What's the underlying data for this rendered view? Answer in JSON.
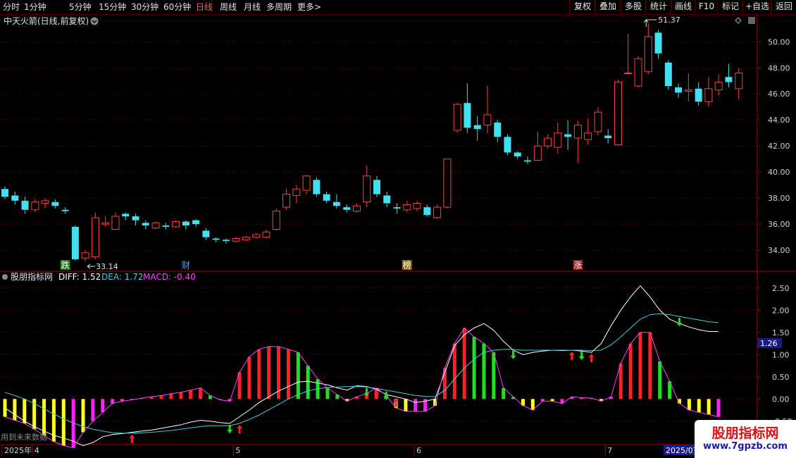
{
  "toolbar": {
    "periods": [
      "分时",
      "1分钟",
      "5分钟",
      "15分钟",
      "30分钟",
      "60分钟",
      "日线",
      "周线",
      "月线",
      "多周期",
      "更多"
    ],
    "active_period": "日线",
    "more_glyph": ">",
    "buttons": [
      "复权",
      "叠加",
      "多股",
      "统计",
      "画线",
      "F10",
      "标记",
      "+自选",
      "返回"
    ]
  },
  "main_panel": {
    "title": "中天火箭(日线,前复权)",
    "dropdown_icon": "chevron-down-icon",
    "diamond_icon": "diamond-icon",
    "high_label": "51.37",
    "low_label": "33.14",
    "markers": [
      {
        "index": 6,
        "text": "跌",
        "bg": "#1a7a1a",
        "color": "#ffffff"
      },
      {
        "index": 18,
        "text": "财",
        "bg": "#000000",
        "color": "#4aa8ff"
      },
      {
        "index": 40,
        "text": "榜",
        "bg": "#8a6a00",
        "color": "#ffffff"
      },
      {
        "index": 57,
        "text": "涨",
        "bg": "#8a1a1a",
        "color": "#ffffff"
      }
    ]
  },
  "indicator_panel": {
    "name": "股朋指标网",
    "diff_label": "DIFF: 1.52",
    "dea_label": "DEA: 1.72",
    "macd_label": "MACD: -0.40",
    "current_value": "1.26",
    "footnote": "用到未来数据"
  },
  "date_axis": {
    "labels": [
      {
        "index": 0,
        "text": "2025年"
      },
      {
        "index": 3,
        "text": "4"
      },
      {
        "index": 23,
        "text": "5"
      },
      {
        "index": 41,
        "text": "6"
      },
      {
        "index": 60,
        "text": "7"
      }
    ],
    "current_date": "2025/07"
  },
  "watermark": {
    "title": "股朋指标网",
    "url": "www.7gpzb.com"
  },
  "colors": {
    "up": "#ff4040",
    "down": "#40e0f0",
    "diff": "#ffffff",
    "dea": "#40d0e0",
    "macd_label": "#ff40ff",
    "bar_red": "#ff2020",
    "bar_green": "#20e020",
    "bar_yellow": "#ffff20",
    "bar_magenta": "#ff20ff",
    "grid": "#8b0000",
    "axis": "#b00000"
  },
  "chart_data": [
    {
      "type": "candlestick",
      "title": "中天火箭(日线,前复权)",
      "yticks": [
        34,
        36,
        38,
        40,
        42,
        44,
        46,
        48,
        50
      ],
      "ytick_labels": [
        "34.00",
        "36.00",
        "38.00",
        "40.00",
        "42.00",
        "44.00",
        "46.00",
        "48.00",
        "50.00"
      ],
      "ylim": [
        32.6,
        51.8
      ],
      "candles": [
        [
          38.7,
          38.1,
          38.9,
          37.9
        ],
        [
          38.2,
          37.8,
          38.5,
          37.5
        ],
        [
          37.8,
          37.1,
          38.1,
          36.8
        ],
        [
          37.1,
          37.7,
          37.9,
          36.9
        ],
        [
          37.6,
          37.8,
          38.0,
          37.2
        ],
        [
          37.7,
          37.4,
          37.9,
          37.2
        ],
        [
          37.1,
          37.0,
          37.3,
          36.8
        ],
        [
          35.8,
          33.3,
          35.9,
          33.2
        ],
        [
          33.4,
          33.8,
          34.0,
          33.14
        ],
        [
          33.5,
          36.5,
          36.9,
          33.3
        ],
        [
          36.0,
          36.1,
          36.6,
          35.8
        ],
        [
          35.6,
          36.6,
          36.9,
          35.6
        ],
        [
          36.8,
          36.6,
          36.9,
          36.3
        ],
        [
          36.6,
          36.3,
          36.8,
          35.9
        ],
        [
          36.1,
          35.9,
          36.3,
          35.6
        ],
        [
          35.7,
          36.1,
          36.2,
          35.6
        ],
        [
          35.9,
          35.8,
          36.1,
          35.6
        ],
        [
          35.8,
          36.2,
          36.3,
          35.7
        ],
        [
          36.2,
          35.9,
          36.3,
          35.6
        ],
        [
          36.3,
          36.0,
          36.4,
          35.8
        ],
        [
          35.5,
          35.0,
          35.7,
          34.8
        ],
        [
          34.9,
          34.8,
          35.0,
          34.6
        ],
        [
          34.8,
          34.7,
          34.9,
          34.5
        ],
        [
          34.7,
          34.9,
          35.0,
          34.6
        ],
        [
          34.8,
          35.0,
          35.1,
          34.7
        ],
        [
          35.0,
          35.2,
          35.3,
          34.9
        ],
        [
          35.0,
          35.4,
          35.6,
          34.9
        ],
        [
          35.6,
          37.0,
          37.2,
          35.5
        ],
        [
          37.3,
          38.3,
          38.7,
          37.1
        ],
        [
          38.2,
          38.7,
          39.0,
          37.6
        ],
        [
          38.6,
          39.7,
          39.8,
          38.3
        ],
        [
          39.4,
          38.3,
          39.6,
          38.1
        ],
        [
          38.3,
          37.8,
          38.5,
          37.6
        ],
        [
          37.7,
          37.4,
          38.3,
          37.2
        ],
        [
          37.3,
          37.1,
          37.5,
          36.9
        ],
        [
          37.0,
          37.4,
          37.6,
          36.9
        ],
        [
          37.7,
          39.7,
          40.5,
          37.3
        ],
        [
          39.4,
          38.3,
          39.7,
          38.1
        ],
        [
          38.2,
          37.6,
          38.5,
          37.3
        ],
        [
          37.3,
          37.2,
          37.6,
          36.8
        ],
        [
          37.1,
          37.5,
          37.8,
          36.9
        ],
        [
          37.2,
          37.6,
          37.8,
          37.0
        ],
        [
          37.3,
          36.7,
          37.5,
          36.6
        ],
        [
          36.5,
          37.3,
          37.5,
          36.4
        ],
        [
          37.3,
          41.0,
          41.0,
          37.2
        ],
        [
          43.2,
          45.2,
          45.3,
          43.0
        ],
        [
          45.3,
          43.4,
          46.8,
          43.0
        ],
        [
          43.6,
          43.3,
          44.3,
          42.4
        ],
        [
          43.6,
          44.4,
          46.6,
          43.0
        ],
        [
          43.8,
          42.7,
          44.0,
          42.3
        ],
        [
          42.7,
          41.5,
          42.9,
          41.3
        ],
        [
          41.5,
          41.2,
          41.6,
          41.0
        ],
        [
          40.9,
          40.8,
          41.2,
          40.6
        ],
        [
          40.9,
          42.0,
          43.1,
          40.9
        ],
        [
          42.0,
          42.6,
          42.9,
          41.8
        ],
        [
          41.9,
          43.0,
          43.8,
          41.4
        ],
        [
          42.9,
          42.7,
          44.0,
          41.7
        ],
        [
          42.6,
          43.6,
          43.9,
          40.7
        ],
        [
          42.5,
          43.0,
          44.1,
          42.1
        ],
        [
          43.1,
          44.6,
          45.0,
          42.8
        ],
        [
          42.8,
          42.6,
          43.3,
          42.2
        ],
        [
          42.1,
          46.9,
          47.1,
          42.0
        ],
        [
          47.6,
          47.6,
          50.6,
          47.6
        ],
        [
          46.6,
          48.7,
          48.9,
          46.5
        ],
        [
          47.7,
          50.4,
          51.37,
          47.5
        ],
        [
          50.7,
          49.1,
          50.9,
          48.7
        ],
        [
          48.4,
          46.6,
          48.6,
          46.3
        ],
        [
          46.5,
          46.1,
          46.8,
          45.7
        ],
        [
          46.2,
          46.3,
          47.6,
          45.4
        ],
        [
          46.4,
          45.4,
          46.9,
          45.1
        ],
        [
          45.4,
          46.4,
          47.3,
          45.0
        ],
        [
          46.3,
          46.9,
          47.5,
          45.9
        ],
        [
          47.3,
          46.9,
          48.3,
          46.5
        ],
        [
          46.4,
          47.6,
          48.0,
          45.6
        ]
      ]
    },
    {
      "type": "bar+line",
      "name": "股朋指标网",
      "yticks": [
        -0.5,
        0,
        0.5,
        1.0,
        1.5,
        2.0,
        2.5
      ],
      "ytick_labels": [
        "-0.50",
        "0.00",
        "0.50",
        "1.00",
        "1.50",
        "2.00",
        "2.50"
      ],
      "ylim": [
        -0.9,
        2.75
      ],
      "series": [
        {
          "name": "DIFF",
          "values": [
            -0.2,
            -0.35,
            -0.5,
            -0.62,
            -0.72,
            -0.82,
            -0.88,
            -0.95,
            -1.05,
            -0.98,
            -0.85,
            -0.8,
            -0.78,
            -0.75,
            -0.72,
            -0.7,
            -0.66,
            -0.62,
            -0.58,
            -0.52,
            -0.48,
            -0.5,
            -0.53,
            -0.55,
            -0.4,
            -0.25,
            -0.08,
            0.05,
            0.18,
            0.28,
            0.38,
            0.4,
            0.36,
            0.32,
            0.25,
            0.2,
            0.3,
            0.28,
            0.22,
            0.1,
            0.05,
            0.0,
            -0.08,
            -0.05,
            0.0,
            0.6,
            1.2,
            1.45,
            1.6,
            1.7,
            1.55,
            1.3,
            1.1,
            1.0,
            1.05,
            1.08,
            1.1,
            1.09,
            1.1,
            1.08,
            1.05,
            1.25,
            1.65,
            2.0,
            2.3,
            2.55,
            2.3,
            2.0,
            1.8,
            1.7,
            1.62,
            1.56,
            1.52,
            1.52
          ]
        },
        {
          "name": "DEA",
          "values": [
            0.15,
            0.08,
            0.0,
            -0.1,
            -0.22,
            -0.34,
            -0.45,
            -0.54,
            -0.62,
            -0.68,
            -0.72,
            -0.76,
            -0.77,
            -0.77,
            -0.76,
            -0.75,
            -0.73,
            -0.71,
            -0.68,
            -0.65,
            -0.62,
            -0.6,
            -0.6,
            -0.6,
            -0.55,
            -0.46,
            -0.36,
            -0.24,
            -0.12,
            0.0,
            0.1,
            0.18,
            0.23,
            0.26,
            0.27,
            0.28,
            0.28,
            0.27,
            0.24,
            0.2,
            0.16,
            0.12,
            0.08,
            0.06,
            0.05,
            0.2,
            0.45,
            0.7,
            0.9,
            1.05,
            1.1,
            1.12,
            1.12,
            1.1,
            1.1,
            1.1,
            1.1,
            1.1,
            1.1,
            1.1,
            1.09,
            1.1,
            1.22,
            1.4,
            1.6,
            1.8,
            1.9,
            1.92,
            1.9,
            1.86,
            1.82,
            1.78,
            1.74,
            1.72
          ]
        },
        {
          "name": "MACD",
          "values": [
            -0.4,
            -0.48,
            -0.55,
            -0.68,
            -0.82,
            -0.96,
            -1.05,
            -1.1,
            -0.75,
            -0.5,
            -0.3,
            -0.1,
            -0.05,
            -0.02,
            0.02,
            0.05,
            0.08,
            0.12,
            0.15,
            0.2,
            0.25,
            0.08,
            -0.02,
            -0.05,
            0.6,
            0.95,
            1.12,
            1.18,
            1.18,
            1.12,
            1.05,
            0.75,
            0.45,
            0.25,
            0.1,
            -0.05,
            0.05,
            0.12,
            0.25,
            0.08,
            -0.2,
            -0.28,
            -0.28,
            -0.28,
            -0.15,
            0.7,
            1.25,
            1.6,
            1.4,
            1.25,
            1.05,
            0.25,
            0.05,
            -0.15,
            -0.25,
            -0.05,
            -0.05,
            -0.1,
            0.05,
            0.03,
            0.02,
            -0.05,
            0.05,
            0.8,
            1.25,
            1.5,
            1.5,
            0.85,
            0.4,
            -0.1,
            -0.25,
            -0.3,
            -0.35,
            -0.4
          ]
        },
        {
          "name": "MACD_colors",
          "values": [
            "y",
            "y",
            "y",
            "y",
            "y",
            "y",
            "y",
            "m",
            "y",
            "m",
            "m",
            "m",
            "m",
            "m",
            "r",
            "r",
            "r",
            "r",
            "r",
            "r",
            "r",
            "g",
            "m",
            "m",
            "r",
            "r",
            "r",
            "r",
            "r",
            "r",
            "g",
            "g",
            "g",
            "g",
            "g",
            "y",
            "r",
            "r",
            "r",
            "g",
            "y",
            "y",
            "m",
            "m",
            "y",
            "r",
            "r",
            "r",
            "g",
            "g",
            "g",
            "g",
            "g",
            "y",
            "y",
            "m",
            "y",
            "m",
            "m",
            "m",
            "m",
            "y",
            "m",
            "r",
            "r",
            "r",
            "r",
            "g",
            "g",
            "y",
            "y",
            "y",
            "y",
            "m"
          ]
        },
        {
          "name": "up_arrows",
          "values": [
            13,
            24,
            38,
            40,
            58,
            60
          ]
        },
        {
          "name": "down_arrows",
          "values": [
            23,
            37,
            39,
            52,
            59,
            69
          ]
        }
      ]
    }
  ]
}
